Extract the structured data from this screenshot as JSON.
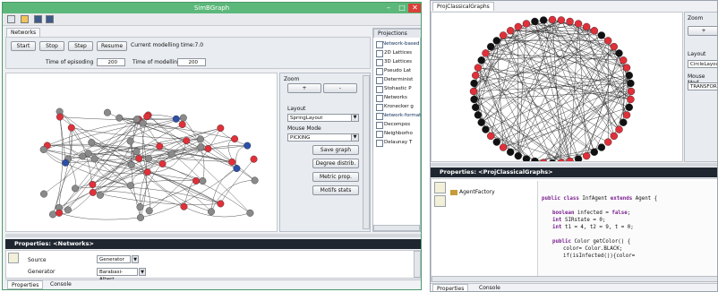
{
  "left_window": {
    "title": "SimBGraph",
    "window_controls": {
      "minimize": "–",
      "maximize": "□",
      "close": "✕"
    },
    "main_tab": "Networks",
    "buttons": {
      "start": "Start",
      "stop": "Stop",
      "step": "Step",
      "resume": "Resume"
    },
    "current_time_label": "Current modelling time:7.0",
    "time_of_episoding_label": "Time of episoding",
    "time_of_episoding_value": "200",
    "time_of_modelling_label": "Time of modelling",
    "time_of_modelling_value": "200",
    "zoom_label": "Zoom",
    "zoom_in": "+",
    "zoom_out": "-",
    "layout_label": "Layout",
    "layout_value": "SpringLayout",
    "mouse_mode_label": "Mouse Mode",
    "mouse_mode_value": "PICKING",
    "action_buttons": [
      "Save graph",
      "Degree distrib.",
      "Metric prop.",
      "Motifs stats"
    ],
    "projections_tab": "Projections",
    "projections_tree": [
      {
        "label": "Network-based",
        "folder": true
      },
      {
        "label": "2D Lattices",
        "folder": false
      },
      {
        "label": "3D Lattices",
        "folder": false
      },
      {
        "label": "Pseudo Lat",
        "folder": false
      },
      {
        "label": "Determinist",
        "folder": false
      },
      {
        "label": "Stohastic P",
        "folder": false
      },
      {
        "label": "Networks",
        "folder": false
      },
      {
        "label": "Kronecker g",
        "folder": false
      },
      {
        "label": "Network-format",
        "folder": true
      },
      {
        "label": "Decompos",
        "folder": false
      },
      {
        "label": "Neighborho",
        "folder": false
      },
      {
        "label": "Delaunay T",
        "folder": false
      }
    ],
    "properties_header": "Properties: <Networks>",
    "properties": [
      {
        "name": "Source",
        "value": "Generator"
      },
      {
        "name": "Generator",
        "value": "Barabasi-Albert"
      }
    ],
    "status_tabs": [
      "Properties",
      "Console"
    ]
  },
  "right_window": {
    "tab": "ProjClassicalGraphs",
    "zoom_label": "Zoom",
    "zoom_in": "+",
    "layout_label": "Layout",
    "layout_value": "CircleLayou",
    "mouse_mode_label": "Mouse Mod",
    "mouse_mode_value": "TRANSFOR",
    "properties_header": "Properties: <ProjClassicalGraphs>",
    "property_item": "AgentFactory",
    "code_lines": [
      {
        "kw": "public class",
        "rest": " InfAgent ",
        "kw2": "extends",
        "rest2": " Agent {"
      },
      {
        "kw": "",
        "rest": "",
        "kw2": "",
        "rest2": ""
      },
      {
        "kw": "boolean",
        "rest": " infected = ",
        "kw2": "false",
        "rest2": ";"
      },
      {
        "kw": "int",
        "rest": " SIRstate = 0;",
        "kw2": "",
        "rest2": ""
      },
      {
        "kw": "int",
        "rest": " t1 = 4, t2 = 9, t = 0;",
        "kw2": "",
        "rest2": ""
      },
      {
        "kw": "",
        "rest": "",
        "kw2": "",
        "rest2": ""
      },
      {
        "kw": "public",
        "rest": " Color getColor() {",
        "kw2": "",
        "rest2": ""
      },
      {
        "kw": "",
        "rest": "color= Color.BLACK;",
        "kw2": "",
        "rest2": ""
      },
      {
        "kw": "",
        "rest": "if(isInfected()){color=",
        "kw2": "",
        "rest2": ""
      }
    ],
    "status_tabs": [
      "Properties",
      "Console"
    ]
  },
  "colors": {
    "red_node": "#e0303a",
    "blue_node": "#2c4fa8",
    "gray_node": "#8a8a8a",
    "black_node": "#111111",
    "title_green": "#5cb87a",
    "dark_header": "#1f2630"
  }
}
